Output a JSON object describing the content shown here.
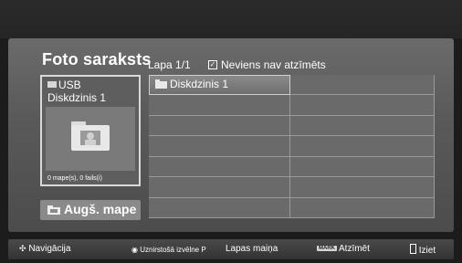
{
  "window": {
    "title": "Foto saraksts"
  },
  "header": {
    "page_info": "Lapa 1/1",
    "check_glyph": "☑",
    "marked_info": "Neviens nav atzīmēts"
  },
  "device": {
    "name_line1": "USB",
    "name_line2": "Diskdzinis 1",
    "meta": "0 mape(s), 0 fails(i)",
    "icon": "folder-icon"
  },
  "up_button": {
    "label": "Augš. mape",
    "icon": "folder-up-icon"
  },
  "grid": {
    "rows": 7,
    "cols": 2,
    "items": [
      {
        "label": "Diskdzinis 1",
        "icon": "folder-icon",
        "selected": true
      }
    ]
  },
  "footer": {
    "navigation": "Navigācija",
    "menu_prefix": "Uznirstošā izvēlne",
    "page_change_key": "P",
    "page_change": "Lapas maiņa",
    "mark_key": "MARK",
    "mark": "Atzīmēt",
    "exit": "Iziet"
  },
  "colors": {
    "panel": "#5a5a5a",
    "background": "#1c1c1c",
    "accent_selected": "#d9d9d9"
  }
}
